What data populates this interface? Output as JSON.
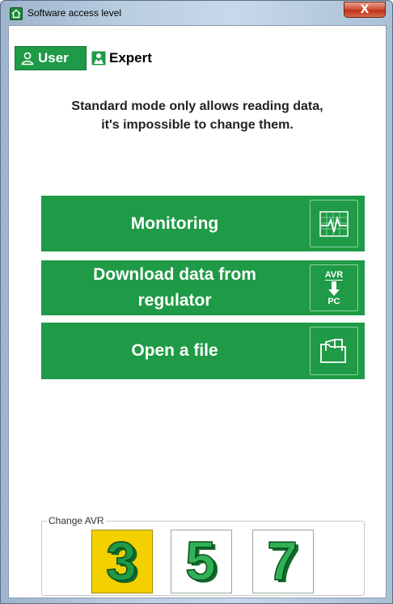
{
  "window": {
    "title": "Software access level",
    "close_label": "X"
  },
  "tabs": [
    {
      "label": "User",
      "selected": true
    },
    {
      "label": "Expert",
      "selected": false
    }
  ],
  "info": {
    "line1": "Standard mode only allows reading data,",
    "line2": "it's impossible to change them."
  },
  "actions": {
    "monitoring": "Monitoring",
    "download_line1": "Download data from",
    "download_line2": "regulator",
    "download_icon_top": "AVR",
    "download_icon_bottom": "PC",
    "open_file": "Open a file"
  },
  "avr": {
    "legend": "Change AVR",
    "options": [
      {
        "label": "3",
        "selected": true
      },
      {
        "label": "5",
        "selected": false
      },
      {
        "label": "7",
        "selected": false
      }
    ]
  },
  "colors": {
    "accent_green": "#1f9a46",
    "selected_yellow": "#f3d000"
  }
}
